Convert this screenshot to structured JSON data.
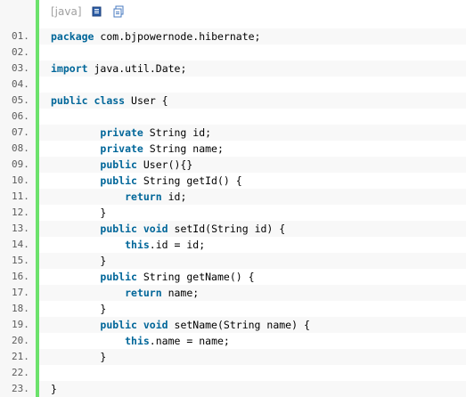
{
  "toolbar": {
    "language_label": "[java]",
    "icons": [
      "view-source-icon",
      "copy-icon"
    ]
  },
  "keywords": [
    "package",
    "import",
    "public",
    "class",
    "private",
    "return",
    "this",
    "void"
  ],
  "lines": [
    {
      "num": "01.",
      "code": "package com.bjpowernode.hibernate;"
    },
    {
      "num": "02.",
      "code": ""
    },
    {
      "num": "03.",
      "code": "import java.util.Date;"
    },
    {
      "num": "04.",
      "code": ""
    },
    {
      "num": "05.",
      "code": "public class User {"
    },
    {
      "num": "06.",
      "code": ""
    },
    {
      "num": "07.",
      "code": "        private String id;"
    },
    {
      "num": "08.",
      "code": "        private String name;"
    },
    {
      "num": "09.",
      "code": "        public User(){}"
    },
    {
      "num": "10.",
      "code": "        public String getId() {"
    },
    {
      "num": "11.",
      "code": "            return id;"
    },
    {
      "num": "12.",
      "code": "        }"
    },
    {
      "num": "13.",
      "code": "        public void setId(String id) {"
    },
    {
      "num": "14.",
      "code": "            this.id = id;"
    },
    {
      "num": "15.",
      "code": "        }"
    },
    {
      "num": "16.",
      "code": "        public String getName() {"
    },
    {
      "num": "17.",
      "code": "            return name;"
    },
    {
      "num": "18.",
      "code": "        }"
    },
    {
      "num": "19.",
      "code": "        public void setName(String name) {"
    },
    {
      "num": "20.",
      "code": "            this.name = name;"
    },
    {
      "num": "21.",
      "code": "        }"
    },
    {
      "num": "22.",
      "code": ""
    },
    {
      "num": "23.",
      "code": "}"
    }
  ],
  "colors": {
    "keyword": "#006699",
    "line_number": "#5c5c5c",
    "gutter_bar": "#6ce26c",
    "language_label": "#a0a0a0"
  }
}
